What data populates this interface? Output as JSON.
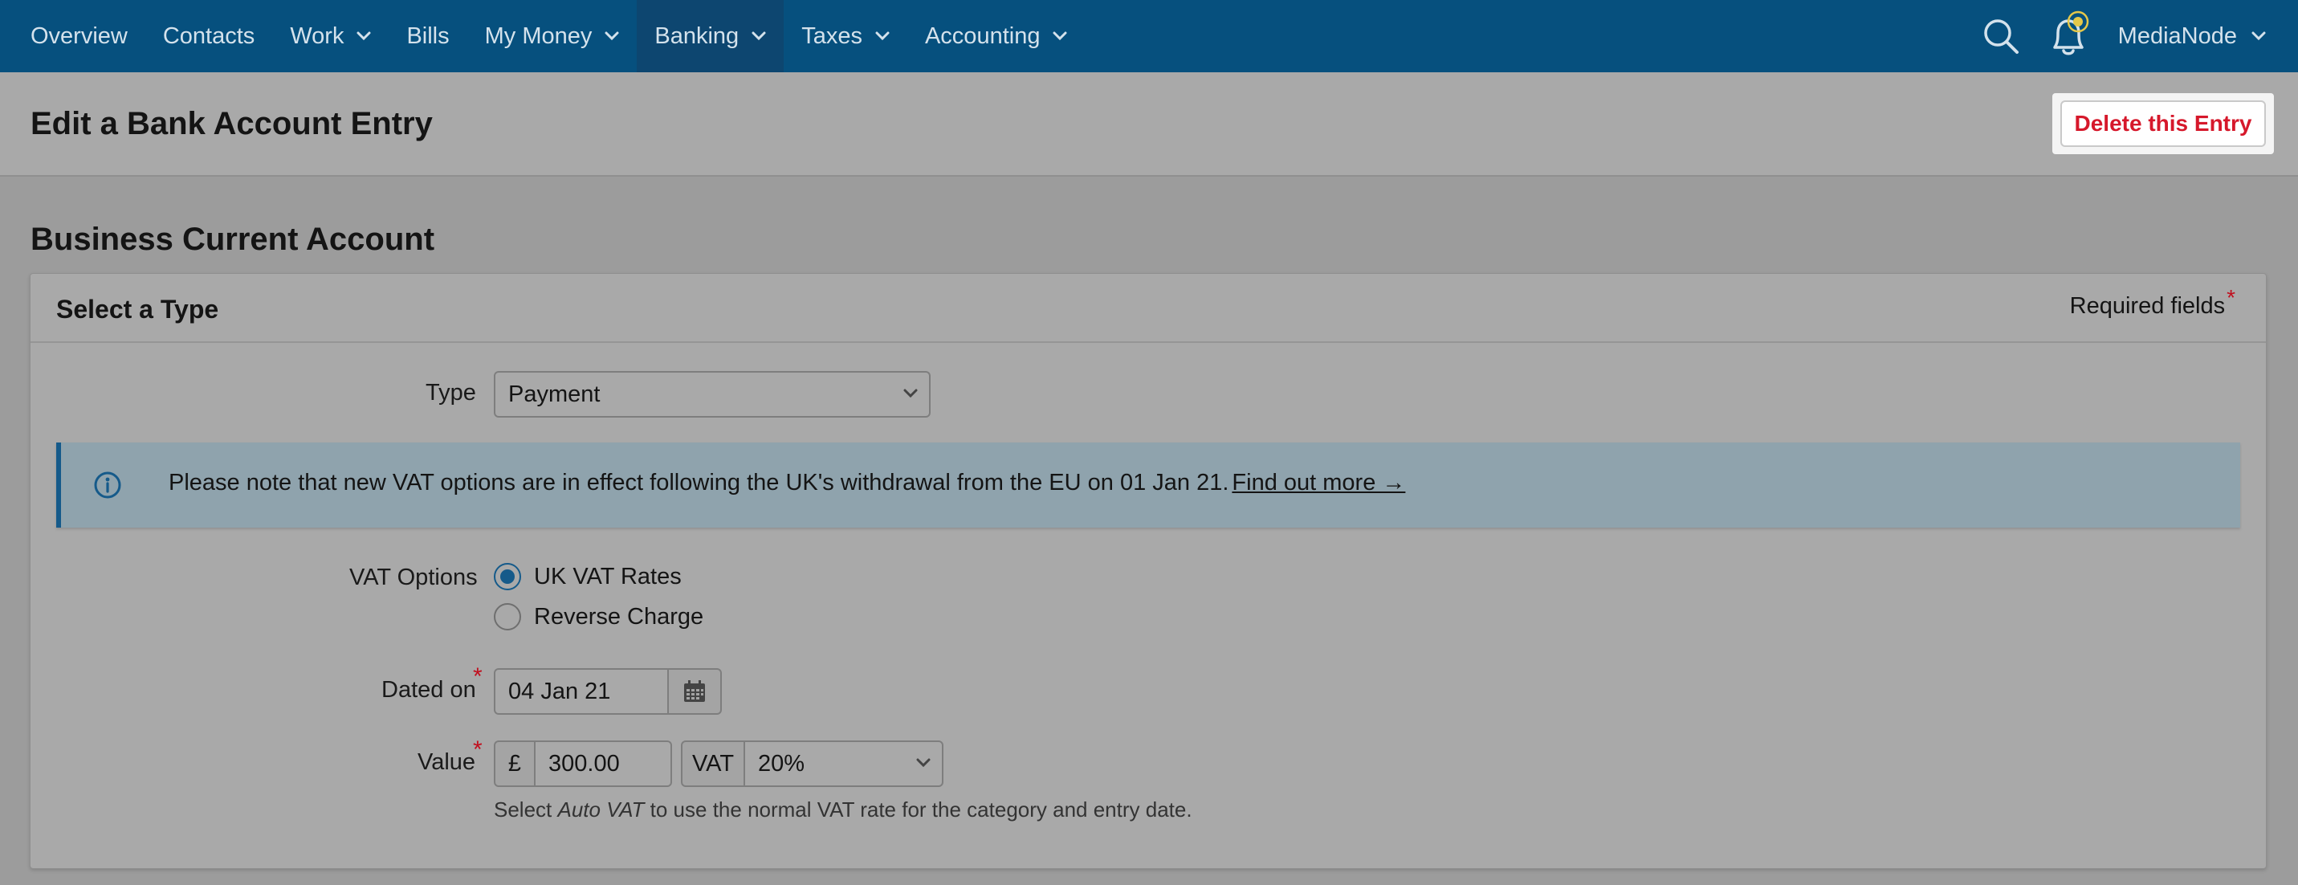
{
  "nav": {
    "items": [
      {
        "label": "Overview",
        "dropdown": false
      },
      {
        "label": "Contacts",
        "dropdown": false
      },
      {
        "label": "Work",
        "dropdown": true
      },
      {
        "label": "Bills",
        "dropdown": false
      },
      {
        "label": "My Money",
        "dropdown": true
      },
      {
        "label": "Banking",
        "dropdown": true,
        "active": true
      },
      {
        "label": "Taxes",
        "dropdown": true
      },
      {
        "label": "Accounting",
        "dropdown": true
      }
    ],
    "user": "MediaNode",
    "icons": [
      "search-icon",
      "bell-icon"
    ],
    "bar_color": "#06507e",
    "active_color": "#0d4670",
    "notification_dot_color": "#e5c84a"
  },
  "page": {
    "title": "Edit a Bank Account Entry",
    "delete_label": "Delete this Entry",
    "delete_color": "#d6182b"
  },
  "section": {
    "title": "Business Current Account"
  },
  "card": {
    "title": "Select a Type",
    "required_text": "Required fields",
    "required_star": "*"
  },
  "form": {
    "type_label": "Type",
    "type_value": "Payment",
    "info_text": "Please note that new VAT options are in effect following the UK's withdrawal from the EU on 01 Jan 21.",
    "info_link": "Find out more →",
    "vat_label": "VAT Options",
    "vat_options": [
      {
        "label": "UK VAT Rates",
        "checked": true
      },
      {
        "label": "Reverse Charge",
        "checked": false
      }
    ],
    "date_label": "Dated on",
    "date_value": "04 Jan 21",
    "value_label": "Value",
    "currency_symbol": "£",
    "amount": "300.00",
    "vat_addon": "VAT",
    "vat_rate": "20%",
    "hint_prefix": "Select ",
    "hint_em": "Auto VAT",
    "hint_suffix": " to use the normal VAT rate for the category and entry date."
  }
}
